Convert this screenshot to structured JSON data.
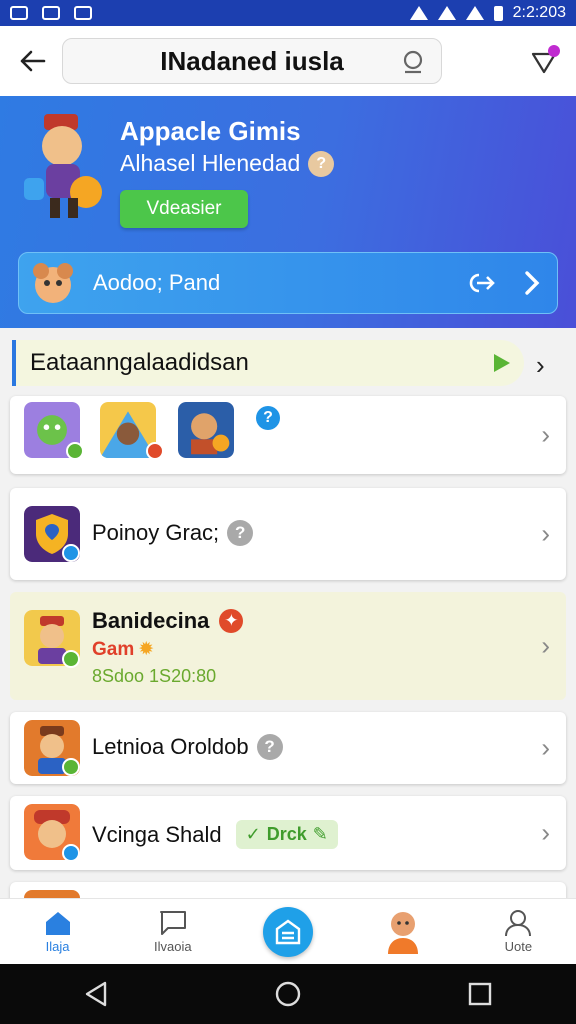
{
  "status_bar": {
    "time": "2:2:203"
  },
  "header": {
    "search_text": "INadaned iusla"
  },
  "hero": {
    "title": "Appacle Gimis",
    "subtitle": "Alhasel Hlenedad",
    "button_label": "Vdeasier",
    "card_label": "Aodoo; Pand"
  },
  "section": {
    "title": "Eataanngalaadidsan"
  },
  "rows": [
    {
      "label": "Poinoy Grac;"
    },
    {
      "title": "Banidecina",
      "subtitle": "Gam",
      "meta": "8Sdoo 1S20:80"
    },
    {
      "label": "Letnioa Oroldob"
    },
    {
      "label": "Vcinga Shald",
      "tag": "Drck"
    }
  ],
  "bottom_nav": [
    {
      "label": "Ilaja",
      "icon": "home-icon"
    },
    {
      "label": "Ilvaoia",
      "icon": "chat-icon"
    },
    {
      "label": "",
      "icon": "center-action-icon"
    },
    {
      "label": "",
      "icon": "profile-avatar-icon"
    },
    {
      "label": "Uote",
      "icon": "person-icon"
    }
  ],
  "colors": {
    "accent": "#2a80e0",
    "hero_start": "#2f7be3",
    "hero_end": "#4a4fd8",
    "button_green": "#4cc64a",
    "highlight_row": "#f3f3dc"
  }
}
